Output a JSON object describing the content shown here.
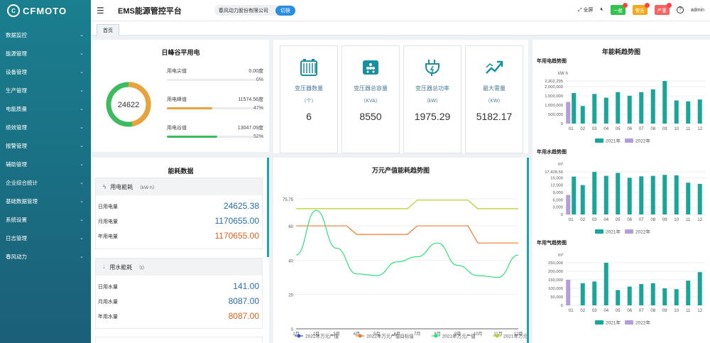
{
  "brand": {
    "logo_text": "CFMOTO",
    "logo_mark": "C"
  },
  "header": {
    "title": "EMS能源管控平台",
    "company": "春风动力股份有限公司",
    "switch_label": "切换",
    "fullscreen_label": "全屏",
    "badge_general": "一般",
    "badge_warning": "警告",
    "badge_severe": "严重",
    "user": "admin"
  },
  "colors": {
    "accent": "#1aa5b1",
    "blue": "#2a8de0",
    "peak": "#e8a33d",
    "valley": "#3dbb5f",
    "green_badge": "#32c24d",
    "orange_badge": "#f2a81d",
    "red_badge": "#f56262"
  },
  "sidebar": {
    "items": [
      {
        "label": "数据监控"
      },
      {
        "label": "能源管理"
      },
      {
        "label": "设备管理"
      },
      {
        "label": "生产管理"
      },
      {
        "label": "电能质量"
      },
      {
        "label": "绩效管理"
      },
      {
        "label": "报警管理"
      },
      {
        "label": "辅助管理"
      },
      {
        "label": "企业综合统计"
      },
      {
        "label": "基础数据管理"
      },
      {
        "label": "系统设置"
      },
      {
        "label": "日志管理"
      },
      {
        "label": "春风动力"
      }
    ]
  },
  "tabs": {
    "home": "首页"
  },
  "peak_valley": {
    "title": "日峰谷平用电",
    "total": "24622",
    "rows": [
      {
        "label": "用电尖值",
        "value": "0.00度",
        "pct": "0%",
        "fraction": 0
      },
      {
        "label": "用电峰值",
        "value": "11574.56度",
        "pct": "47%",
        "fraction": 0.47
      },
      {
        "label": "用电谷值",
        "value": "13047.09度",
        "pct": "52%",
        "fraction": 0.52
      }
    ]
  },
  "stats": [
    {
      "name": "变压器数量",
      "unit": "（个）",
      "value": "6",
      "icon": "transformer-icon"
    },
    {
      "name": "变压器总容量",
      "unit": "（KVA）",
      "value": "8550",
      "icon": "capacity-icon"
    },
    {
      "name": "变压器总功率",
      "unit": "（kW）",
      "value": "1975.29",
      "icon": "power-plug-icon"
    },
    {
      "name": "最大需量",
      "unit": "（KW）",
      "value": "5182.17",
      "icon": "trend-arrow-icon"
    }
  ],
  "energy": {
    "title": "能耗数据",
    "electric": {
      "title": "用电能耗",
      "unit": "（kW·h）",
      "rows": [
        {
          "k": "日用电量",
          "v": "24625.38",
          "color": "#2a6db0"
        },
        {
          "k": "月用电量",
          "v": "1170655.00",
          "color": "#2a6db0"
        },
        {
          "k": "年用电量",
          "v": "1170655.00",
          "color": "#e0621c"
        }
      ]
    },
    "water": {
      "title": "用水能耗",
      "unit": "（t）",
      "rows": [
        {
          "k": "日用水量",
          "v": "141.00",
          "color": "#2a6db0"
        },
        {
          "k": "月用水量",
          "v": "8087.00",
          "color": "#2a6db0"
        },
        {
          "k": "年用水量",
          "v": "8087.00",
          "color": "#e0621c"
        }
      ]
    }
  },
  "trend_title": "万元产值能耗趋势图",
  "yearly_title": "年能耗趋势图",
  "chart_data": [
    {
      "type": "line",
      "title": "",
      "categories": [
        "1月",
        "2月",
        "3月",
        "4月",
        "5月",
        "6月",
        "7月",
        "8月",
        "9月",
        "10月",
        "11月",
        "12月"
      ],
      "yticks": [
        "0",
        "20",
        "40",
        "60",
        "75.75"
      ],
      "ylim": [
        0,
        75.75
      ],
      "series": [
        {
          "name": "2022年万元产值",
          "color": "#3656c4",
          "values": []
        },
        {
          "name": "2022年万元产值目标值",
          "color": "#f07a2a",
          "values": [
            60,
            60,
            60,
            55,
            55,
            55,
            60,
            60,
            60,
            50,
            50,
            50
          ]
        },
        {
          "name": "2021年万元产值",
          "color": "#2ee07a",
          "values": [
            43,
            69,
            47,
            32,
            31,
            39,
            42,
            50,
            37,
            31,
            30,
            43
          ]
        },
        {
          "name": "2021年万元产值目标值",
          "color": "#b8cc2a",
          "values": [
            70,
            70,
            70,
            70,
            70,
            70,
            75,
            75,
            75,
            70,
            70,
            70
          ]
        }
      ],
      "legend": "bottom"
    },
    {
      "type": "bar",
      "title": "年用电趋势图",
      "unit": "kW·h",
      "categories": [
        "01",
        "02",
        "03",
        "04",
        "05",
        "06",
        "07",
        "08",
        "09",
        "10",
        "11",
        "12"
      ],
      "ytick_labels": [
        "0",
        "500,000",
        "1,000,000",
        "1,500,000",
        "2,000,000",
        "2,302,295"
      ],
      "yticks": [
        0,
        500000,
        1000000,
        1500000,
        2000000,
        2302295
      ],
      "ylim": [
        0,
        2302295
      ],
      "series": [
        {
          "name": "2021年",
          "color": "#1aa59a",
          "values": [
            1650000,
            950000,
            1600000,
            1400000,
            1700000,
            1500000,
            1700000,
            1850000,
            2300000,
            1250000,
            1200000,
            1300000
          ]
        },
        {
          "name": "2022年",
          "color": "#b39ddb",
          "values": [
            1170000,
            0,
            0,
            0,
            0,
            0,
            0,
            0,
            0,
            0,
            0,
            0
          ]
        }
      ],
      "legend": "bottom"
    },
    {
      "type": "bar",
      "title": "年用水趋势图",
      "unit": "m³",
      "categories": [
        "01",
        "02",
        "03",
        "04",
        "05",
        "06",
        "07",
        "08",
        "09",
        "10",
        "11",
        "12"
      ],
      "ytick_labels": [
        "0",
        "3,000",
        "6,000",
        "9,000",
        "12,000",
        "15,000",
        "17,428.56"
      ],
      "yticks": [
        0,
        3000,
        6000,
        9000,
        12000,
        15000,
        17428.56
      ],
      "ylim": [
        0,
        17428.56
      ],
      "series": [
        {
          "name": "2021年",
          "color": "#1aa59a",
          "values": [
            15500,
            12000,
            17400,
            15800,
            17000,
            15000,
            15600,
            15800,
            16200,
            16000,
            13000,
            12500
          ]
        },
        {
          "name": "2022年",
          "color": "#b39ddb",
          "values": [
            8000,
            0,
            0,
            0,
            0,
            0,
            0,
            0,
            0,
            0,
            0,
            0
          ]
        }
      ],
      "legend": "bottom"
    },
    {
      "type": "bar",
      "title": "年用气趋势图",
      "unit": "m³",
      "categories": [
        "01",
        "02",
        "03",
        "04",
        "05",
        "06",
        "07",
        "08",
        "09",
        "10",
        "11",
        "12"
      ],
      "ytick_labels": [
        "0",
        "50,000",
        "100,000",
        "150,000",
        "200,000",
        "250,000"
      ],
      "yticks": [
        0,
        50000,
        100000,
        150000,
        200000,
        250000
      ],
      "ylim": [
        0,
        250000
      ],
      "series": [
        {
          "name": "2021年",
          "color": "#1aa59a",
          "values": [
            0,
            130000,
            140000,
            250000,
            90000,
            110000,
            125000,
            130000,
            100000,
            95000,
            145000,
            195000
          ]
        },
        {
          "name": "2022年",
          "color": "#b39ddb",
          "values": [
            150000,
            0,
            0,
            0,
            0,
            0,
            0,
            0,
            0,
            0,
            0,
            0
          ]
        }
      ],
      "legend": "bottom"
    }
  ]
}
